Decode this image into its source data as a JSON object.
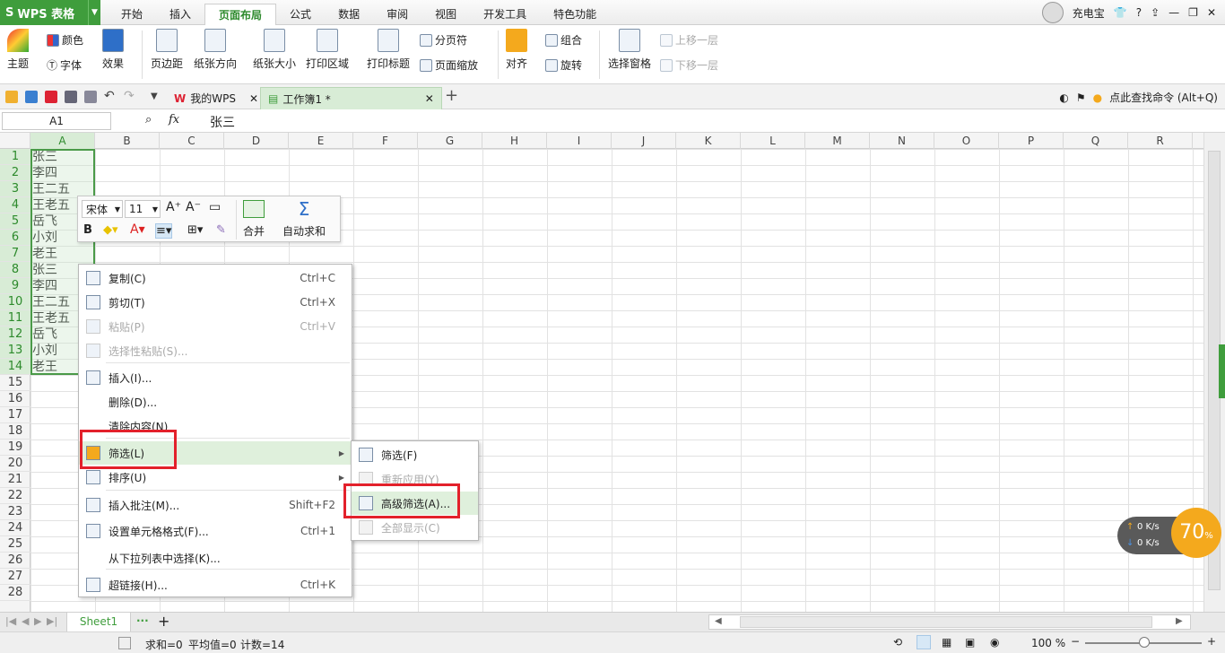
{
  "app": {
    "name": "WPS 表格"
  },
  "menu": {
    "tabs": [
      "开始",
      "插入",
      "页面布局",
      "公式",
      "数据",
      "审阅",
      "视图",
      "开发工具",
      "特色功能"
    ],
    "active": "页面布局"
  },
  "topright": {
    "user": "充电宝"
  },
  "ribbon": {
    "theme": "主题",
    "color": "颜色",
    "font": "字体",
    "effect": "效果",
    "margin": "页边距",
    "orientation": "纸张方向",
    "size": "纸张大小",
    "print_area": "打印区域",
    "print_title": "打印标题",
    "page_break": "分页符",
    "page_scale": "页面缩放",
    "align": "对齐",
    "group": "组合",
    "rotate": "旋转",
    "selection_pane": "选择窗格",
    "bring_forward": "上移一层",
    "send_backward": "下移一层"
  },
  "doctabs": {
    "wps": "我的WPS",
    "book": "工作簿1 *"
  },
  "search": {
    "hint": "点此查找命令 (Alt+Q)"
  },
  "formula": {
    "cell_ref": "A1",
    "fx": "fx",
    "value": "张三"
  },
  "columns": [
    "A",
    "B",
    "C",
    "D",
    "E",
    "F",
    "G",
    "H",
    "I",
    "J",
    "K",
    "L",
    "M",
    "N",
    "O",
    "P",
    "Q",
    "R"
  ],
  "rows": [
    "1",
    "2",
    "3",
    "4",
    "5",
    "6",
    "7",
    "8",
    "9",
    "10",
    "11",
    "12",
    "13",
    "14",
    "15",
    "16",
    "17",
    "18",
    "19",
    "20",
    "21",
    "22",
    "23",
    "24",
    "25",
    "26",
    "27",
    "28"
  ],
  "cells": [
    "张三",
    "李四",
    "王二五",
    "王老五",
    "岳飞",
    "小刘",
    "老王",
    "张三",
    "李四",
    "王二五",
    "王老五",
    "岳飞",
    "小刘",
    "老王"
  ],
  "minitoolbar": {
    "font": "宋体",
    "size": "11",
    "merge": "合并",
    "autosum": "自动求和"
  },
  "context_menu": [
    {
      "label": "复制(C)",
      "shortcut": "Ctrl+C",
      "disabled": false
    },
    {
      "label": "剪切(T)",
      "shortcut": "Ctrl+X",
      "disabled": false
    },
    {
      "label": "粘贴(P)",
      "shortcut": "Ctrl+V",
      "disabled": true
    },
    {
      "label": "选择性粘贴(S)...",
      "shortcut": "",
      "disabled": true
    },
    {
      "label": "插入(I)...",
      "shortcut": "",
      "disabled": false
    },
    {
      "label": "删除(D)...",
      "shortcut": "",
      "disabled": false
    },
    {
      "label": "清除内容(N)",
      "shortcut": "",
      "disabled": false
    },
    {
      "label": "筛选(L)",
      "shortcut": "",
      "disabled": false
    },
    {
      "label": "排序(U)",
      "shortcut": "",
      "disabled": false
    },
    {
      "label": "插入批注(M)...",
      "shortcut": "Shift+F2",
      "disabled": false
    },
    {
      "label": "设置单元格格式(F)...",
      "shortcut": "Ctrl+1",
      "disabled": false
    },
    {
      "label": "从下拉列表中选择(K)...",
      "shortcut": "",
      "disabled": false
    },
    {
      "label": "超链接(H)...",
      "shortcut": "Ctrl+K",
      "disabled": false
    }
  ],
  "submenu": [
    {
      "label": "筛选(F)",
      "disabled": false
    },
    {
      "label": "重新应用(Y)",
      "disabled": true
    },
    {
      "label": "高级筛选(A)...",
      "disabled": false
    },
    {
      "label": "全部显示(C)",
      "disabled": true
    }
  ],
  "sheets": {
    "active": "Sheet1",
    "add": "+"
  },
  "status": {
    "sum": "求和=0",
    "avg": "平均值=0",
    "count": "计数=14",
    "zoom": "100 %"
  },
  "net": {
    "up": "0 K/s",
    "down": "0 K/s",
    "percent": "70",
    "unit": "%"
  },
  "colors": {
    "accent": "#3f9d3c",
    "highlight": "#e3212b"
  }
}
